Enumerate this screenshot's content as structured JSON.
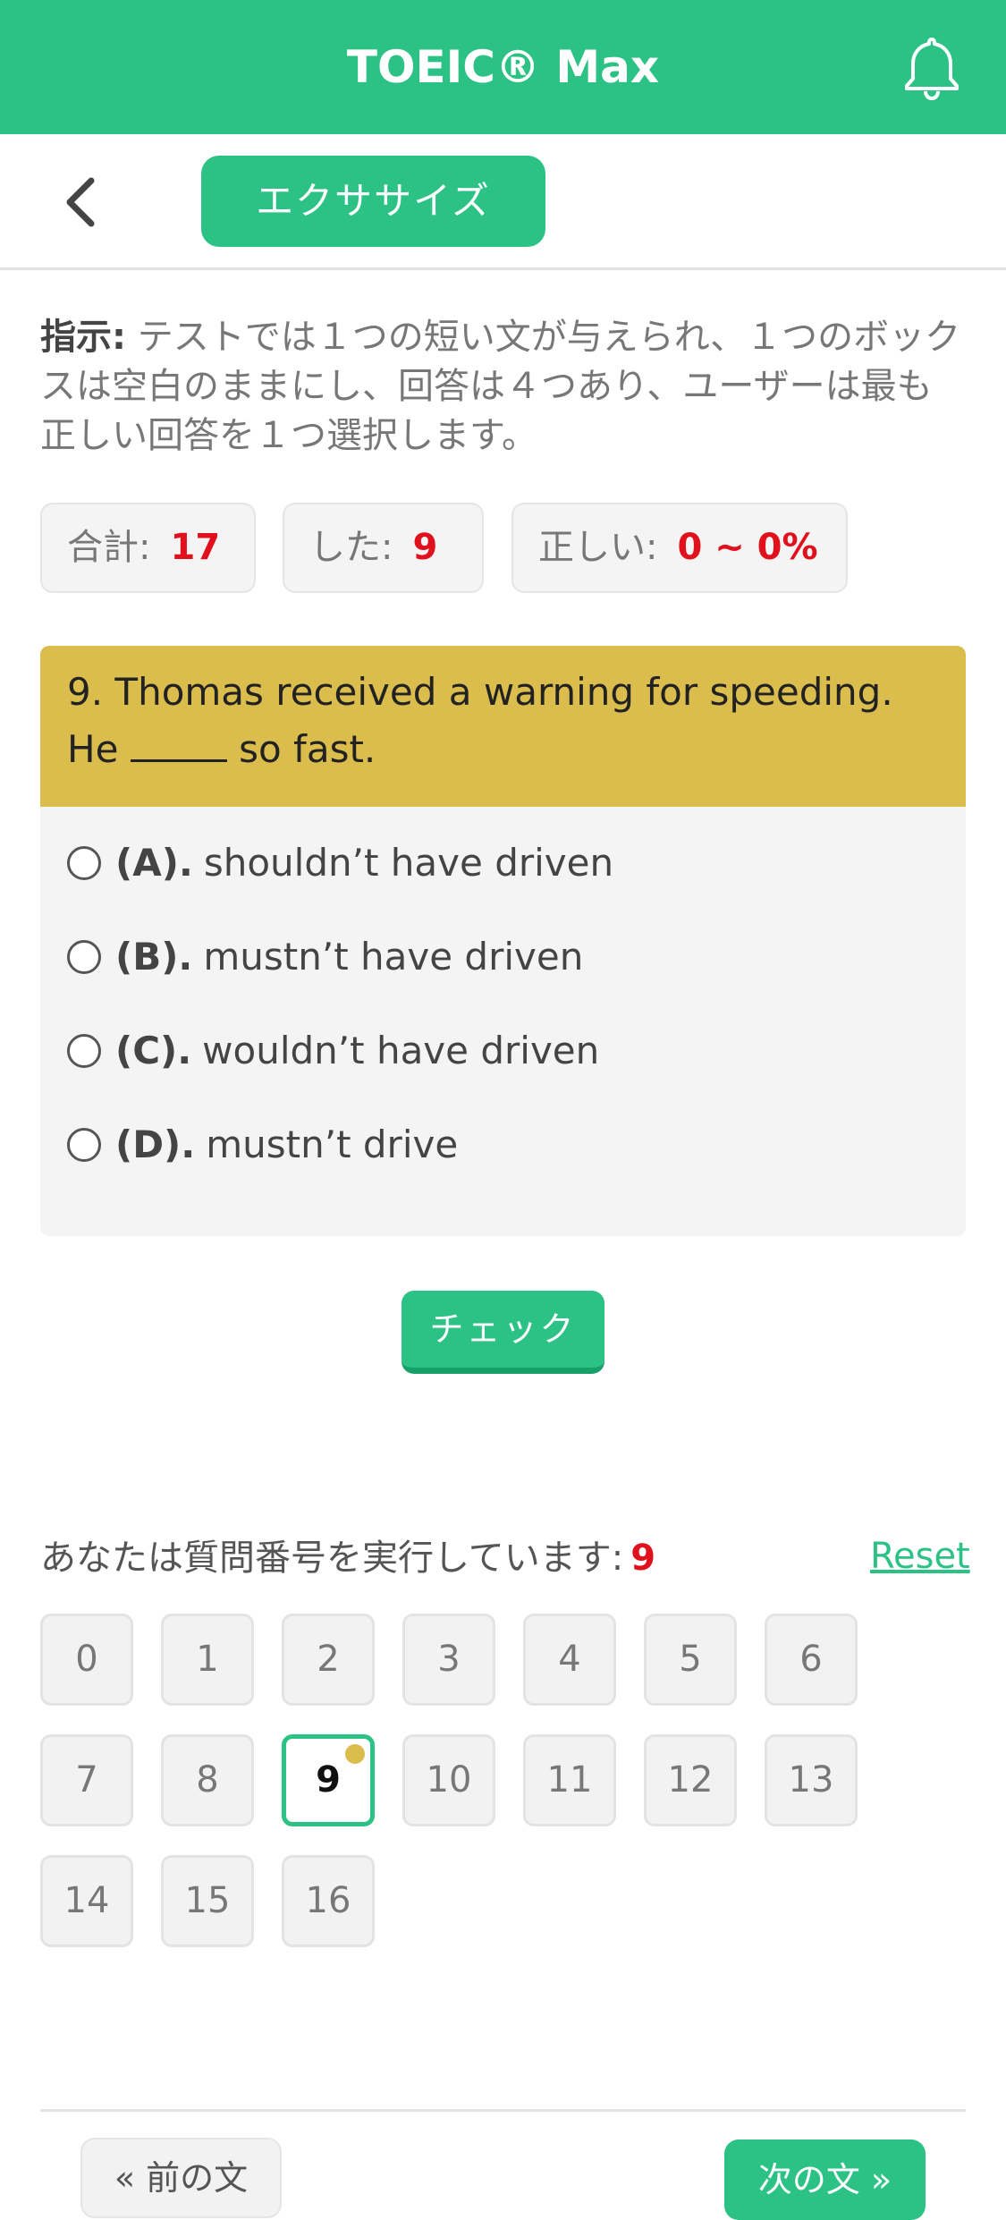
{
  "header": {
    "title": "TOEIC® Max",
    "bell_icon": "bell-icon"
  },
  "subbar": {
    "back_icon": "chevron-left-icon",
    "exercise_label": "エクササイズ"
  },
  "instructions": {
    "label": "指示:",
    "text": " テストでは１つの短い文が与えられ、１つのボックスは空白のままにし、回答は４つあり、ユーザーは最も正しい回答を１つ選択します。"
  },
  "stats": {
    "total_label": "合計:",
    "total_value": "17",
    "done_label": "した:",
    "done_value": "9",
    "correct_label": "正しい:",
    "correct_value": "0 ~ 0%"
  },
  "question": {
    "text_before": "9. Thomas received a warning for speeding. He ",
    "text_after": " so fast.",
    "options": [
      {
        "letter": "(A).",
        "text": "shouldn’t have driven"
      },
      {
        "letter": "(B).",
        "text": "mustn’t have driven"
      },
      {
        "letter": "(C).",
        "text": "wouldn’t have driven"
      },
      {
        "letter": "(D).",
        "text": "mustn’t drive"
      }
    ]
  },
  "check_label": "チェック",
  "navigator": {
    "running_label": "あなたは質問番号を実行しています:",
    "current": "9",
    "reset_label": "Reset",
    "numbers": [
      "0",
      "1",
      "2",
      "3",
      "4",
      "5",
      "6",
      "7",
      "8",
      "9",
      "10",
      "11",
      "12",
      "13",
      "14",
      "15",
      "16"
    ]
  },
  "footer": {
    "prev_label": "« 前の文",
    "next_label": "次の文 »"
  },
  "colors": {
    "brand": "#2dc285",
    "question_bg": "#dbbd4d",
    "accent_red": "#e0101c"
  }
}
